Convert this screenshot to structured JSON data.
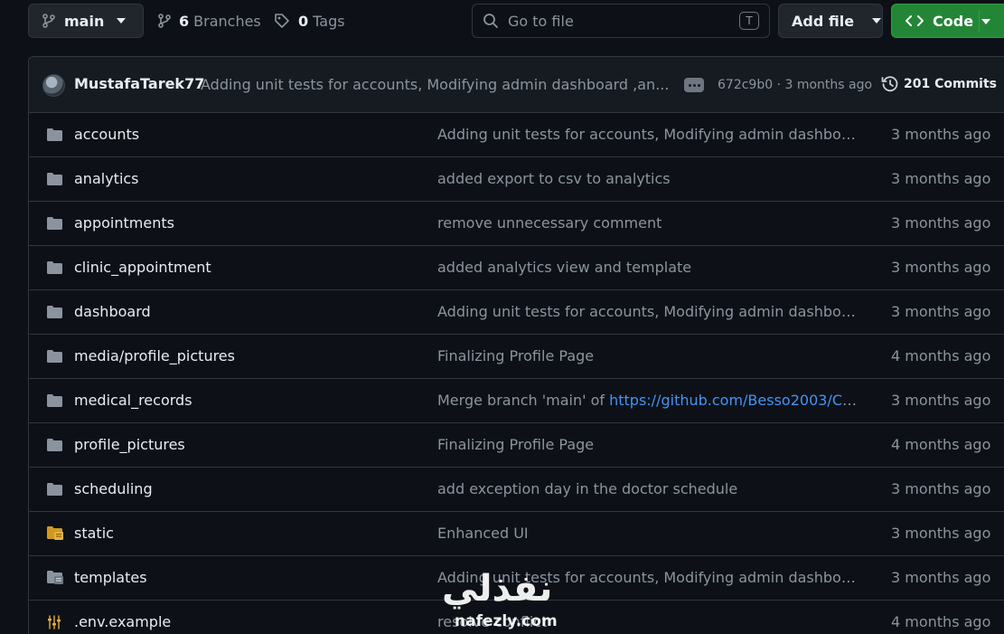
{
  "toolbar": {
    "branch_name": "main",
    "branches_count": "6",
    "branches_label": "Branches",
    "tags_count": "0",
    "tags_label": "Tags",
    "search_placeholder": "Go to file",
    "search_shortcut": "T",
    "add_file_label": "Add file",
    "code_label": "Code",
    "code_button_color": "#238636"
  },
  "latest_commit": {
    "author": "MustafaTarek77",
    "message": "Adding unit tests for accounts, Modifying admin dashboard ,an...",
    "sha_time": "672c9b0 · 3 months ago",
    "commits_label": "201 Commits"
  },
  "files": [
    {
      "name": "accounts",
      "icon": "folder-icon",
      "message": "Adding unit tests for accounts, Modifying admin dashboa...",
      "date": "3 months ago"
    },
    {
      "name": "analytics",
      "icon": "folder-icon",
      "message": "added export to csv to analytics",
      "date": "3 months ago"
    },
    {
      "name": "appointments",
      "icon": "folder-icon",
      "message": "remove unnecessary comment",
      "date": "3 months ago"
    },
    {
      "name": "clinic_appointment",
      "icon": "folder-icon",
      "message": "added analytics view and template",
      "date": "3 months ago"
    },
    {
      "name": "dashboard",
      "icon": "folder-icon",
      "message": "Adding unit tests for accounts, Modifying admin dashboa...",
      "date": "3 months ago"
    },
    {
      "name": "media/profile_pictures",
      "icon": "folder-icon",
      "message": "Finalizing Profile Page",
      "date": "4 months ago"
    },
    {
      "name": "medical_records",
      "icon": "folder-icon",
      "message": "Merge branch 'main' of ",
      "message_link": "https://github.com/Besso2003/Cli...",
      "date": "3 months ago"
    },
    {
      "name": "profile_pictures",
      "icon": "folder-icon",
      "message": "Finalizing Profile Page",
      "date": "4 months ago"
    },
    {
      "name": "scheduling",
      "icon": "folder-icon",
      "message": "add exception day in the doctor schedule",
      "date": "3 months ago"
    },
    {
      "name": "static",
      "icon": "yellow-folder-icon",
      "message": "Enhanced UI",
      "date": "3 months ago"
    },
    {
      "name": "templates",
      "icon": "template-folder-icon",
      "message": "Adding unit tests for accounts, Modifying admin dashboa...",
      "date": "3 months ago"
    },
    {
      "name": ".env.example",
      "icon": "settings-file-icon",
      "message": "resolve conflict",
      "date": "4 months ago"
    }
  ],
  "watermark": {
    "arabic": "نفذلي",
    "latin": "nafezly.com"
  }
}
